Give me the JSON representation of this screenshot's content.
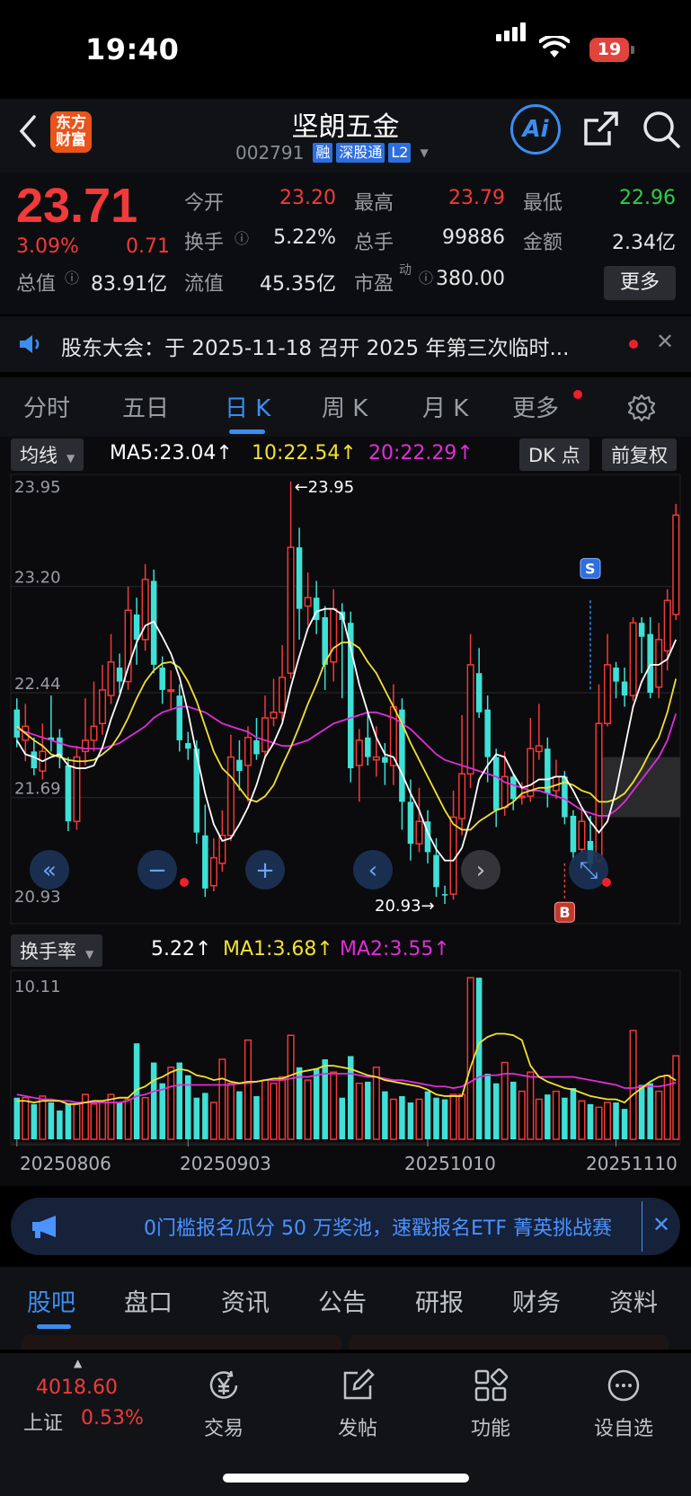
{
  "status": {
    "time": "19:40",
    "battery": "19"
  },
  "header": {
    "title": "坚朗五金",
    "code": "002791",
    "tags": [
      "融",
      "深股通",
      "L2"
    ],
    "logo_line1": "东方",
    "logo_line2": "财富",
    "ai_label": "Ai"
  },
  "quote": {
    "price": "23.71",
    "change_pct": "3.09%",
    "change_abs": "0.71",
    "open_label": "今开",
    "open": "23.20",
    "high_label": "最高",
    "high": "23.79",
    "low_label": "最低",
    "low": "22.96",
    "turnover_label": "换手",
    "turnover": "5.22%",
    "volume_label": "总手",
    "volume": "99886",
    "amount_label": "金额",
    "amount": "2.34亿",
    "mktcap_label": "总值",
    "mktcap": "83.91亿",
    "float_label": "流值",
    "float": "45.35亿",
    "pe_label": "市盈",
    "pe_sup": "动",
    "pe": "380.00",
    "more": "更多"
  },
  "notice": {
    "text": "股东大会：于 2025-11-18 召开 2025 年第三次临时..."
  },
  "tabs": {
    "items": [
      "分时",
      "五日",
      "日 K",
      "周 K",
      "月 K",
      "更多"
    ],
    "active": 2
  },
  "ma_bar": {
    "selector": "均线",
    "ma5": "MA5:23.04↑",
    "ma10": "10:22.54↑",
    "ma20": "20:22.29↑",
    "dk": "DK 点",
    "fq": "前复权"
  },
  "turnover_bar": {
    "selector": "换手率",
    "value": "5.22↑",
    "ma1": "MA1:3.68↑",
    "ma2": "MA2:3.55↑"
  },
  "colors": {
    "up": "#f23a3a",
    "down": "#3fe0d6",
    "ma5": "#ffffff",
    "ma10": "#f2e132",
    "ma20": "#e02ed8",
    "accent": "#3b8ef0"
  },
  "chart_data": {
    "type": "candlestick",
    "price_ticks": [
      "23.95",
      "23.20",
      "22.44",
      "21.69",
      "20.93"
    ],
    "high_marker": "←23.95",
    "low_marker": "20.93→",
    "signals": [
      "S",
      "B"
    ],
    "dates": [
      "20250806",
      "20250903",
      "20251010",
      "20251110"
    ],
    "turnover_max_label": "10.11",
    "candles": [
      [
        22.32,
        22.12,
        22.4,
        22.05
      ],
      [
        22.1,
        22.2,
        22.36,
        21.95
      ],
      [
        22.02,
        21.9,
        22.12,
        21.85
      ],
      [
        21.88,
        22.02,
        22.22,
        21.82
      ],
      [
        22.12,
        22.1,
        22.42,
        22.02
      ],
      [
        22.12,
        21.98,
        22.18,
        21.9
      ],
      [
        21.92,
        21.52,
        21.98,
        21.45
      ],
      [
        21.52,
        21.98,
        22.06,
        21.46
      ],
      [
        22.02,
        22.1,
        22.4,
        21.92
      ],
      [
        22.1,
        22.2,
        22.52,
        22.02
      ],
      [
        22.22,
        22.46,
        22.64,
        22.14
      ],
      [
        22.42,
        22.66,
        22.86,
        22.36
      ],
      [
        22.62,
        22.52,
        22.72,
        22.44
      ],
      [
        22.52,
        23.03,
        23.2,
        22.46
      ],
      [
        23.0,
        22.82,
        23.12,
        22.64
      ],
      [
        22.82,
        23.25,
        23.36,
        22.74
      ],
      [
        23.24,
        22.64,
        23.32,
        22.58
      ],
      [
        22.62,
        22.46,
        22.7,
        22.36
      ],
      [
        22.46,
        22.46,
        22.6,
        22.32
      ],
      [
        22.42,
        22.1,
        22.5,
        22.02
      ],
      [
        22.08,
        22.04,
        22.16,
        21.96
      ],
      [
        22.04,
        21.44,
        22.1,
        21.36
      ],
      [
        21.42,
        21.04,
        21.64,
        20.98
      ],
      [
        21.06,
        21.26,
        21.4,
        21.02
      ],
      [
        21.22,
        21.42,
        21.6,
        21.16
      ],
      [
        21.42,
        21.98,
        22.14,
        21.38
      ],
      [
        21.96,
        21.88,
        22.1,
        21.74
      ],
      [
        21.92,
        22.12,
        22.2,
        21.66
      ],
      [
        22.1,
        22.0,
        22.26,
        21.96
      ],
      [
        22.02,
        22.26,
        22.42,
        21.98
      ],
      [
        22.26,
        22.3,
        22.54,
        22.2
      ],
      [
        22.3,
        22.55,
        22.78,
        22.24
      ],
      [
        22.58,
        23.48,
        23.95,
        22.54
      ],
      [
        23.48,
        23.04,
        23.62,
        22.82
      ],
      [
        23.06,
        23.12,
        23.3,
        22.92
      ],
      [
        23.12,
        22.96,
        23.24,
        22.86
      ],
      [
        22.98,
        22.64,
        23.06,
        22.46
      ],
      [
        22.66,
        23.04,
        23.18,
        22.52
      ],
      [
        23.02,
        22.96,
        23.08,
        22.4
      ],
      [
        22.94,
        21.9,
        23.02,
        21.8
      ],
      [
        21.92,
        22.1,
        22.18,
        21.66
      ],
      [
        22.12,
        21.98,
        22.3,
        21.92
      ],
      [
        21.96,
        21.98,
        22.2,
        21.84
      ],
      [
        21.98,
        21.94,
        22.08,
        21.78
      ],
      [
        21.92,
        22.34,
        22.5,
        21.78
      ],
      [
        22.32,
        21.66,
        22.4,
        21.46
      ],
      [
        21.66,
        21.36,
        21.82,
        21.24
      ],
      [
        21.36,
        21.52,
        21.76,
        21.3
      ],
      [
        21.52,
        21.3,
        21.6,
        21.22
      ],
      [
        21.28,
        21.05,
        21.4,
        20.98
      ],
      [
        21.0,
        20.99,
        21.06,
        20.93
      ],
      [
        21.0,
        21.55,
        21.74,
        20.96
      ],
      [
        21.54,
        21.86,
        22.28,
        21.42
      ],
      [
        21.86,
        22.64,
        22.86,
        21.76
      ],
      [
        22.58,
        22.3,
        22.76,
        22.26
      ],
      [
        22.32,
        21.98,
        22.42,
        21.8
      ],
      [
        21.98,
        21.6,
        22.04,
        21.48
      ],
      [
        21.62,
        21.84,
        22.02,
        21.56
      ],
      [
        21.84,
        21.68,
        21.86,
        21.6
      ],
      [
        21.7,
        21.7,
        21.8,
        21.64
      ],
      [
        21.7,
        22.04,
        22.26,
        21.66
      ],
      [
        22.02,
        22.06,
        22.36,
        21.96
      ],
      [
        22.04,
        21.72,
        22.12,
        21.62
      ],
      [
        21.74,
        21.84,
        21.96,
        21.68
      ],
      [
        21.84,
        21.55,
        21.88,
        21.5
      ],
      [
        21.56,
        21.3,
        21.6,
        21.24
      ],
      [
        21.32,
        21.52,
        21.6,
        21.3
      ],
      [
        21.38,
        21.22,
        21.56,
        21.18
      ],
      [
        21.24,
        22.22,
        22.5,
        21.22
      ],
      [
        22.22,
        22.64,
        22.86,
        22.2
      ],
      [
        22.62,
        22.52,
        22.66,
        22.4
      ],
      [
        22.52,
        22.42,
        22.62,
        22.34
      ],
      [
        22.42,
        22.94,
        22.98,
        22.38
      ],
      [
        22.94,
        22.84,
        22.98,
        22.58
      ],
      [
        22.86,
        22.44,
        22.98,
        22.4
      ],
      [
        22.48,
        22.82,
        22.94,
        22.4
      ],
      [
        22.74,
        23.1,
        23.18,
        22.6
      ],
      [
        23.0,
        23.71,
        23.79,
        22.96
      ]
    ],
    "ma5": [
      22.1,
      22.0,
      21.98,
      21.95,
      21.98,
      22.0,
      21.92,
      21.9,
      21.9,
      21.92,
      22.05,
      22.25,
      22.42,
      22.62,
      22.8,
      22.92,
      22.95,
      22.84,
      22.72,
      22.55,
      22.3,
      22.0,
      21.72,
      21.5,
      21.38,
      21.4,
      21.5,
      21.62,
      21.78,
      21.98,
      22.08,
      22.22,
      22.48,
      22.7,
      22.9,
      23.02,
      23.04,
      23.04,
      23.0,
      22.76,
      22.5,
      22.3,
      22.12,
      22.0,
      21.98,
      21.86,
      21.72,
      21.6,
      21.44,
      21.32,
      21.24,
      21.24,
      21.33,
      21.54,
      21.82,
      21.92,
      22.0,
      21.98,
      21.86,
      21.76,
      21.78,
      21.82,
      21.82,
      21.84,
      21.84,
      21.74,
      21.62,
      21.52,
      21.44,
      21.52,
      21.74,
      22.04,
      22.34,
      22.52,
      22.64,
      22.64,
      22.68,
      22.82
    ],
    "ma10": [
      22.2,
      22.15,
      22.1,
      22.06,
      22.0,
      21.98,
      21.96,
      21.95,
      21.95,
      21.96,
      22.0,
      22.05,
      22.14,
      22.26,
      22.4,
      22.52,
      22.6,
      22.65,
      22.66,
      22.62,
      22.52,
      22.38,
      22.2,
      22.02,
      21.9,
      21.84,
      21.76,
      21.68,
      21.66,
      21.7,
      21.78,
      21.92,
      22.05,
      22.2,
      22.36,
      22.5,
      22.66,
      22.76,
      22.8,
      22.8,
      22.76,
      22.66,
      22.58,
      22.46,
      22.34,
      22.22,
      22.08,
      21.96,
      21.84,
      21.72,
      21.6,
      21.5,
      21.46,
      21.46,
      21.52,
      21.56,
      21.6,
      21.62,
      21.66,
      21.72,
      21.74,
      21.76,
      21.76,
      21.78,
      21.8,
      21.78,
      21.74,
      21.72,
      21.66,
      21.66,
      21.68,
      21.72,
      21.8,
      21.9,
      22.02,
      22.12,
      22.3,
      22.54
    ],
    "ma20": [
      22.18,
      22.16,
      22.14,
      22.12,
      22.1,
      22.08,
      22.06,
      22.05,
      22.04,
      22.04,
      22.04,
      22.06,
      22.08,
      22.12,
      22.16,
      22.2,
      22.26,
      22.3,
      22.32,
      22.34,
      22.34,
      22.32,
      22.3,
      22.26,
      22.22,
      22.2,
      22.18,
      22.16,
      22.12,
      22.1,
      22.08,
      22.06,
      22.06,
      22.08,
      22.1,
      22.14,
      22.18,
      22.22,
      22.24,
      22.26,
      22.28,
      22.3,
      22.3,
      22.28,
      22.26,
      22.22,
      22.18,
      22.12,
      22.06,
      22.0,
      21.96,
      21.94,
      21.92,
      21.9,
      21.88,
      21.86,
      21.84,
      21.8,
      21.78,
      21.76,
      21.74,
      21.74,
      21.72,
      21.7,
      21.68,
      21.64,
      21.6,
      21.58,
      21.56,
      21.56,
      21.6,
      21.66,
      21.74,
      21.82,
      21.9,
      21.98,
      22.1,
      22.29
    ],
    "turnover": [
      2.6,
      2.6,
      2.2,
      2.7,
      2.3,
      1.8,
      2.2,
      2.2,
      2.8,
      2.2,
      2.3,
      2.8,
      2.3,
      2.5,
      6.0,
      2.6,
      4.8,
      3.5,
      4.5,
      4.8,
      4.0,
      2.6,
      2.9,
      2.3,
      5.0,
      3.5,
      3.0,
      6.2,
      2.7,
      3.7,
      3.5,
      3.9,
      6.5,
      4.5,
      3.7,
      4.4,
      5.0,
      4.2,
      2.6,
      5.2,
      3.5,
      3.6,
      4.5,
      3.0,
      2.5,
      2.7,
      2.3,
      2.5,
      3.0,
      2.6,
      2.5,
      2.8,
      2.8,
      10.1,
      10.1,
      4.1,
      3.5,
      4.8,
      3.6,
      3.0,
      4.2,
      2.5,
      2.8,
      3.0,
      2.6,
      3.2,
      2.4,
      2.2,
      2.0,
      2.3,
      2.3,
      1.9,
      6.8,
      3.4,
      3.5,
      3.0,
      4.0,
      5.22
    ],
    "turnover_ma1": [
      2.4,
      2.4,
      2.3,
      2.4,
      2.4,
      2.4,
      2.2,
      2.2,
      2.3,
      2.4,
      2.4,
      2.5,
      2.6,
      2.6,
      3.1,
      3.3,
      3.7,
      3.9,
      4.2,
      4.4,
      4.3,
      4.0,
      3.9,
      3.7,
      3.8,
      3.6,
      3.5,
      3.6,
      3.6,
      3.7,
      3.8,
      3.8,
      4.0,
      4.2,
      4.3,
      4.4,
      4.6,
      4.6,
      4.5,
      4.4,
      4.2,
      4.0,
      3.9,
      3.7,
      3.6,
      3.5,
      3.4,
      3.3,
      3.1,
      2.8,
      2.7,
      2.7,
      2.7,
      4.5,
      6.0,
      6.4,
      6.6,
      6.6,
      6.5,
      6.2,
      4.6,
      3.9,
      3.6,
      3.4,
      3.2,
      3.1,
      2.9,
      2.7,
      2.6,
      2.5,
      2.5,
      2.3,
      2.8,
      3.2,
      3.6,
      3.9,
      4.0,
      3.68
    ],
    "turnover_ma2": [
      2.8,
      2.7,
      2.6,
      2.5,
      2.5,
      2.4,
      2.4,
      2.3,
      2.3,
      2.3,
      2.3,
      2.3,
      2.3,
      2.4,
      2.7,
      2.8,
      3.0,
      3.1,
      3.3,
      3.4,
      3.4,
      3.4,
      3.4,
      3.4,
      3.4,
      3.4,
      3.5,
      3.5,
      3.6,
      3.7,
      3.7,
      3.7,
      3.8,
      3.9,
      3.9,
      4.0,
      4.1,
      4.1,
      4.1,
      4.1,
      4.0,
      3.9,
      3.9,
      3.8,
      3.7,
      3.7,
      3.6,
      3.5,
      3.4,
      3.3,
      3.3,
      3.2,
      3.3,
      3.6,
      3.9,
      4.0,
      4.0,
      4.1,
      4.1,
      4.0,
      3.9,
      3.9,
      3.9,
      3.9,
      3.9,
      3.9,
      3.8,
      3.7,
      3.6,
      3.5,
      3.4,
      3.2,
      3.2,
      3.3,
      3.3,
      3.3,
      3.4,
      3.55
    ]
  },
  "banner": {
    "text": "0门槛报名瓜分 50 万奖池，速戳报名ETF 菁英挑战赛"
  },
  "bottom_tabs": {
    "items": [
      "股吧",
      "盘口",
      "资讯",
      "公告",
      "研报",
      "财务",
      "资料"
    ],
    "active": 0
  },
  "nav": {
    "index_value": "4018.60",
    "index_name": "上证",
    "index_pct": "0.53%",
    "items": [
      "交易",
      "发帖",
      "功能",
      "设自选"
    ]
  }
}
